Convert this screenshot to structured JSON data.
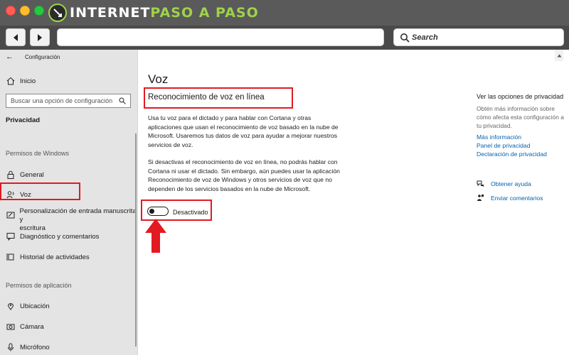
{
  "browser": {
    "logo_part1": "INTERNET",
    "logo_part2": "PASO A PASO",
    "search_placeholder": "Search",
    "colors": {
      "chrome_dark": "#5a5a5a",
      "logo_accent": "#9fd34a"
    }
  },
  "settings": {
    "app_title": "Configuración",
    "sidebar": {
      "home": "Inicio",
      "search_placeholder": "Buscar una opción de configuración",
      "category": "Privacidad",
      "section_windows": "Permisos de Windows",
      "items_windows": [
        {
          "label": "General",
          "icon": "lock-icon"
        },
        {
          "label": "Voz",
          "icon": "voice-icon"
        },
        {
          "label": "Personalización de entrada manuscrita y",
          "label2": "escritura",
          "icon": "pen-icon"
        },
        {
          "label": "Diagnóstico y comentarios",
          "icon": "feedback-icon"
        },
        {
          "label": "Historial de actividades",
          "icon": "timeline-icon"
        }
      ],
      "section_app": "Permisos de aplicación",
      "items_app": [
        {
          "label": "Ubicación",
          "icon": "location-icon"
        },
        {
          "label": "Cámara",
          "icon": "camera-icon"
        },
        {
          "label": "Micrófono",
          "icon": "microphone-icon"
        }
      ]
    },
    "main": {
      "title": "Voz",
      "subtitle": "Reconocimiento de voz en línea",
      "paragraph1": "Usa tu voz para el dictado y para hablar con Cortana y otras aplicaciones que usan el reconocimiento de voz basado en la nube de Microsoft. Usaremos tus datos de voz para ayudar a mejorar nuestros servicios de voz.",
      "paragraph2": "Si desactivas el reconocimiento de voz en línea, no podrás hablar con Cortana ni usar el dictado. Sin embargo, aún puedes usar la aplicación Reconocimiento de voz de Windows y otros servicios de voz que no dependen de los servicios basados en la nube de Microsoft.",
      "toggle_state": "off",
      "toggle_label": "Desactivado"
    },
    "right": {
      "title": "Ver las opciones de privacidad",
      "text": "Obtén más información sobre cómo afecta esta configuración a tu privacidad.",
      "links": [
        "Más información",
        "Panel de privacidad",
        "Declaración de privacidad"
      ],
      "help": "Obtener ayuda",
      "feedback": "Enviar comentarios"
    },
    "highlight_color": "#e21a22",
    "link_color": "#0063b1"
  }
}
